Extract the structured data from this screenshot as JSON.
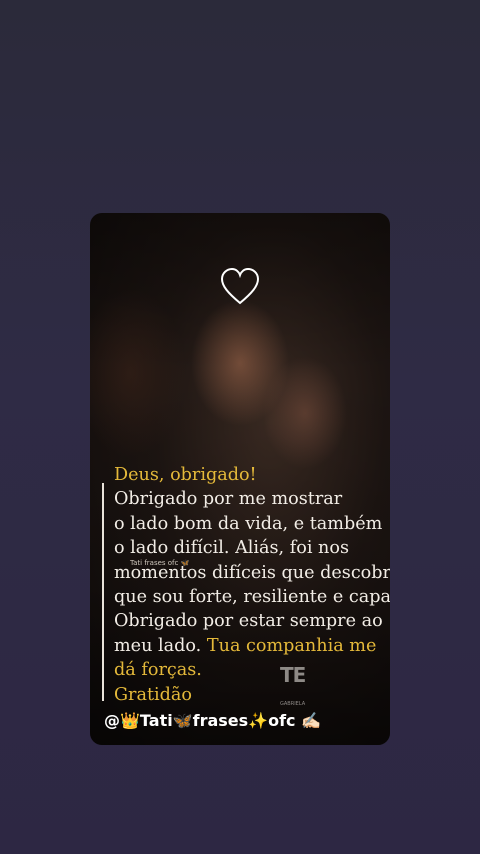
{
  "post": {
    "heart_icon": "heart-outline-icon",
    "lines": [
      {
        "text": "Deus, obrigado!",
        "accent": true
      },
      {
        "text": "Obrigado por me mostrar",
        "accent": false
      },
      {
        "text": "o lado bom da vida, e também",
        "accent": false
      },
      {
        "text": "o lado difícil. Aliás, foi nos",
        "accent": false
      },
      {
        "text": "momentos difíceis que descobri",
        "accent": false
      },
      {
        "text": "que sou forte, resiliente e capaz.",
        "accent": false
      },
      {
        "text": "Obrigado por estar sempre ao",
        "accent": false
      }
    ],
    "line8_plain": "meu lado. ",
    "line8_accent": "Tua companhia me",
    "line9_accent": "dá forças.",
    "line10": "Gratidão",
    "small_watermark": "Tati frases ofc 🦋",
    "logo": "TE",
    "logo_sub": "GABRIELA",
    "handle": "@👑Tati🦋frases✨ofc ✍🏻",
    "accent_color": "#e4b93a"
  }
}
